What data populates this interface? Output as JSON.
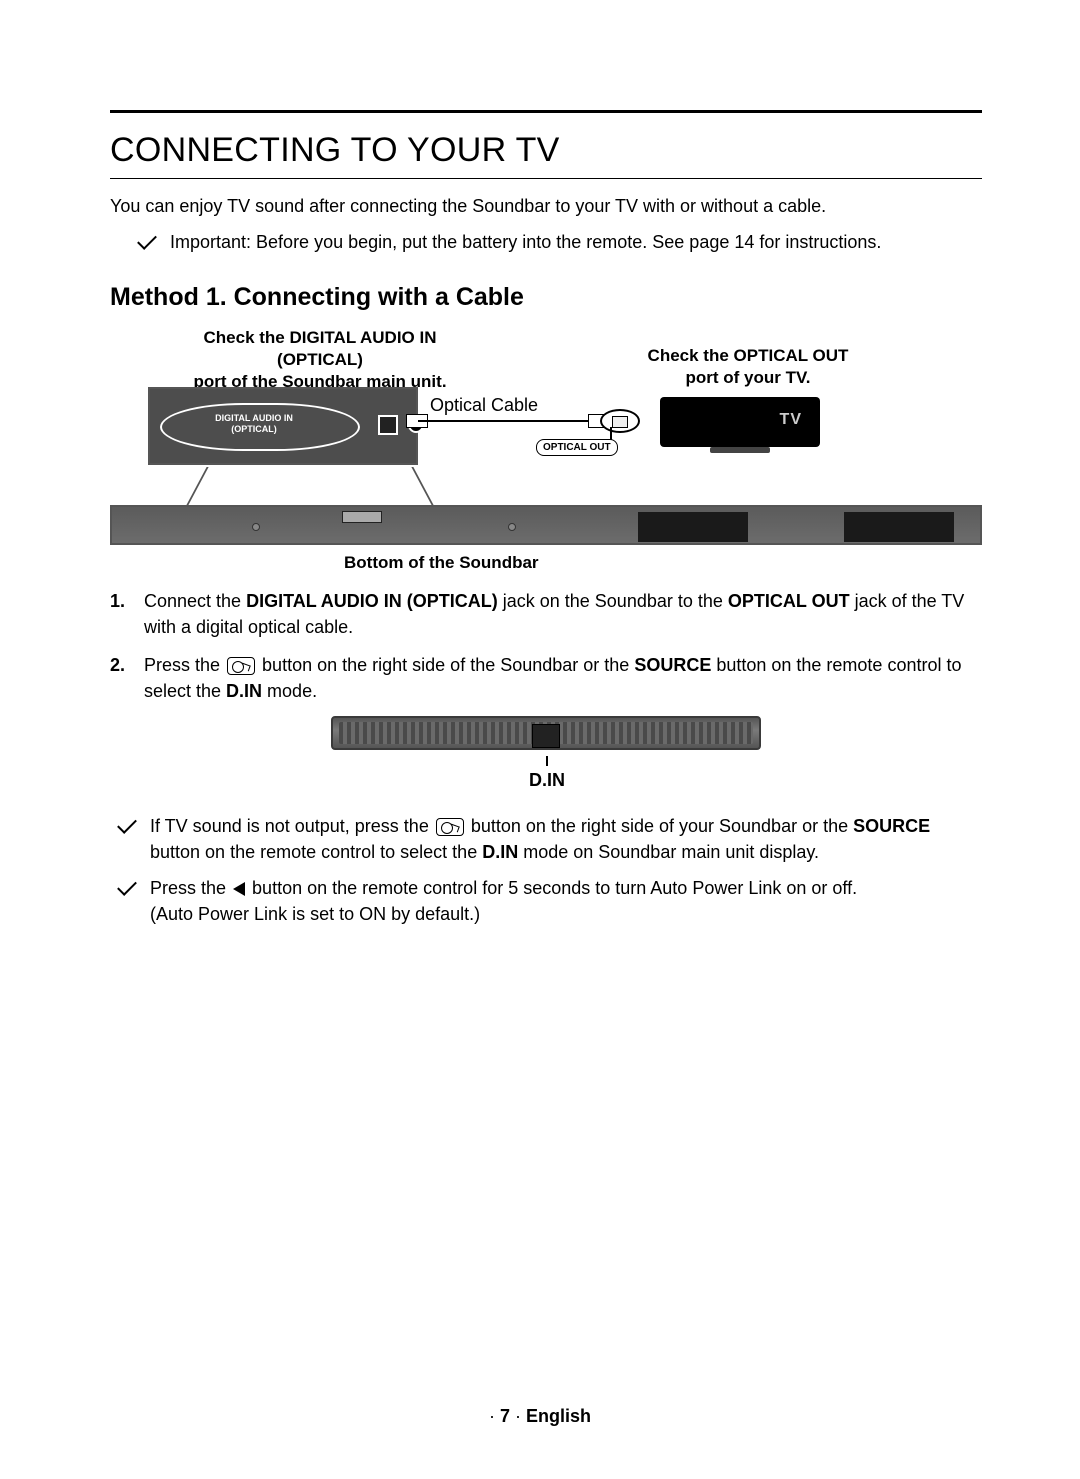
{
  "header": {
    "title": "CONNECTING TO YOUR TV"
  },
  "intro": "You can enjoy TV sound after connecting the Soundbar to your TV with or without a cable.",
  "important_note": "Important: Before you begin, put the battery into the remote. See page 14 for instructions.",
  "method": {
    "title": "Method 1. Connecting with a Cable"
  },
  "diagram": {
    "callout_left_line1": "Check the DIGITAL AUDIO IN (OPTICAL)",
    "callout_left_line2": "port of the Soundbar main unit.",
    "callout_right_line1": "Check the OPTICAL OUT",
    "callout_right_line2": "port of your TV.",
    "optical_cable_label": "Optical Cable",
    "tv_label": "TV",
    "digital_in_label_line1": "DIGITAL AUDIO IN",
    "digital_in_label_line2": "(OPTICAL)",
    "optical_out_label": "OPTICAL OUT",
    "bottom_caption": "Bottom of the Soundbar"
  },
  "steps": {
    "s1_pre": "Connect the ",
    "s1_b1": "DIGITAL AUDIO IN (OPTICAL)",
    "s1_mid": " jack on the Soundbar to the ",
    "s1_b2": "OPTICAL OUT",
    "s1_post": " jack of the TV with a digital optical cable.",
    "s2_pre": "Press the ",
    "s2_mid": " button on the right side of the Soundbar or the ",
    "s2_b1": "SOURCE",
    "s2_mid2": " button on the remote control to select the ",
    "s2_b2": "D.IN",
    "s2_post": " mode."
  },
  "din_label": "D.IN",
  "notes": {
    "n1_pre": "If TV sound is not output, press the ",
    "n1_mid": " button on the right side of your Soundbar or the ",
    "n1_b1": "SOURCE",
    "n1_mid2": " button on the remote control to select the ",
    "n1_b2": "D.IN",
    "n1_post": " mode on Soundbar main unit display.",
    "n2_pre": "Press the ",
    "n2_mid": " button on the remote control for 5 seconds to turn Auto Power Link on or off.",
    "n2_sub": "(Auto Power Link is set to ON by default.)"
  },
  "footer": {
    "dot1": "· ",
    "page": "7",
    "dot2": " · ",
    "lang": "English"
  }
}
